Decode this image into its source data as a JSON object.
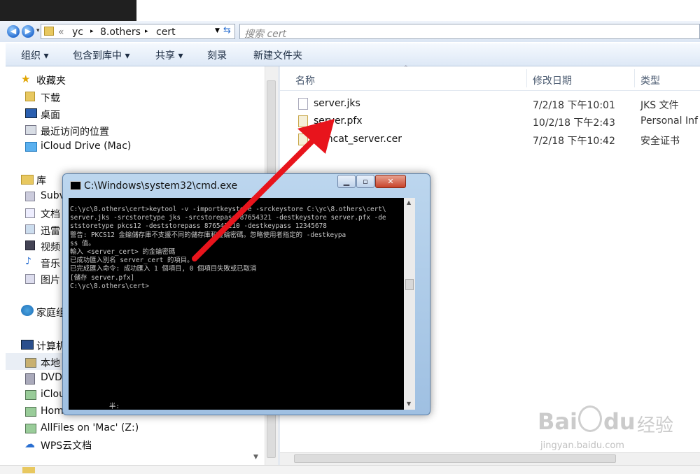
{
  "address": {
    "crumbs": [
      "yc",
      "8.others",
      "cert"
    ],
    "prefix": "«",
    "search_placeholder": "搜索 cert"
  },
  "toolbar": {
    "organize": "组织 ▾",
    "include_library": "包含到库中 ▾",
    "share": "共享 ▾",
    "burn": "刻录",
    "new_folder": "新建文件夹"
  },
  "nav": {
    "favorites_title": "收藏夹",
    "favorites": [
      "下载",
      "桌面",
      "最近访问的位置",
      "iCloud Drive (Mac)"
    ],
    "libraries_title": "库",
    "libraries": [
      "Subv",
      "文档",
      "迅雷",
      "视频",
      "音乐",
      "图片"
    ],
    "homegroup": "家庭组",
    "computer_title": "计算机",
    "computer": [
      "本地",
      "DVD",
      "iClou",
      "Home",
      "AllFiles on 'Mac' (Z:)",
      "WPS云文档"
    ]
  },
  "columns": {
    "name": "名称",
    "modified": "修改日期",
    "type": "类型"
  },
  "files": [
    {
      "name": "server.jks",
      "modified": "7/2/18 下午10:01",
      "type": "JKS 文件"
    },
    {
      "name": "server.pfx",
      "modified": "10/2/18 下午2:43",
      "type": "Personal Inf"
    },
    {
      "name": "mcat_server.cer",
      "modified": "7/2/18 下午10:42",
      "type": "安全证书"
    }
  ],
  "cmd": {
    "title": "C:\\Windows\\system32\\cmd.exe",
    "lines": [
      "C:\\yc\\8.others\\cert>keytool -v -importkeystore -srckeystore C:\\yc\\8.others\\cert\\",
      "server.jks -srcstoretype jks -srcstorepass 87654321 -destkeystore server.pfx -de",
      "ststoretype pkcs12 -deststorepass 876543210 -destkeypass 12345678",
      "警告: PKCS12 金鑰儲存庫不支援不同的儲存庫和金鑰密碼。忽略使用者指定的 -destkeypa",
      "ss 值。",
      "輸入 <server_cert> 的金鑰密碼",
      "已成功匯入別名 server_cert 的項目。",
      "已完成匯入命令: 成功匯入 1 個項目, 0 個項目失敗或已取消",
      "[儲存 server.pfx]",
      "",
      "C:\\yc\\8.others\\cert>"
    ],
    "footer": "半:"
  },
  "watermark": {
    "brand": "Bai",
    "brand2": "du",
    "cn": "经验",
    "url": "jingyan.baidu.com"
  },
  "colors": {
    "arrow": "#e8141c",
    "accent": "#2a6fd1"
  }
}
